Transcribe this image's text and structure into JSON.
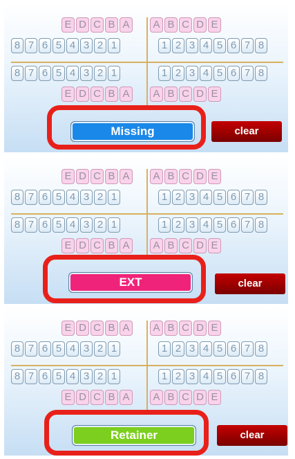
{
  "left_letters": [
    "E",
    "D",
    "C",
    "B",
    "A"
  ],
  "right_letters": [
    "A",
    "B",
    "C",
    "D",
    "E"
  ],
  "left_numbers": [
    "8",
    "7",
    "6",
    "5",
    "4",
    "3",
    "2",
    "1"
  ],
  "right_numbers": [
    "1",
    "2",
    "3",
    "4",
    "5",
    "6",
    "7",
    "8"
  ],
  "panels": [
    {
      "mode_label": "Missing",
      "mode_color": "#1a88e8",
      "clear_label": "clear"
    },
    {
      "mode_label": "EXT",
      "mode_color": "#f0237a",
      "clear_label": "clear"
    },
    {
      "mode_label": "Retainer",
      "mode_color": "#7ccf1e",
      "clear_label": "clear"
    }
  ],
  "colors": {
    "highlight": "#e8201a",
    "divider": "#d8b060",
    "letter_key": "#f9d3ea",
    "clear_button": "#b00000"
  }
}
